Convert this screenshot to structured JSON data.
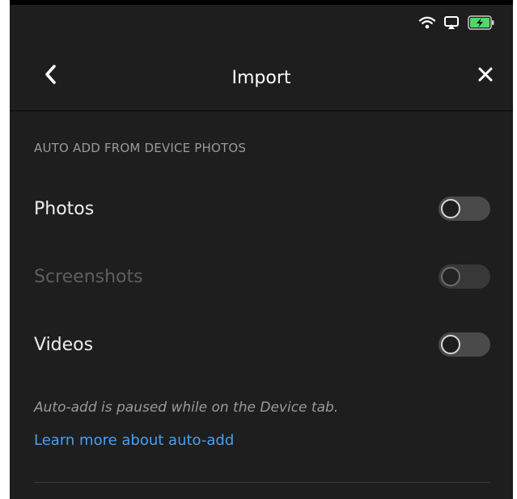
{
  "header": {
    "title": "Import"
  },
  "icons": {
    "back": "chevron-left-icon",
    "close": "close-icon",
    "wifi": "wifi-icon",
    "airplay": "airplay-icon",
    "battery": "battery-charging-icon"
  },
  "colors": {
    "background": "#1e1e1e",
    "text": "#eeeeee",
    "muted": "#9a9a9a",
    "link": "#4a9ff0",
    "battery": "#4cd964"
  },
  "section": {
    "header": "AUTO ADD FROM DEVICE PHOTOS",
    "items": [
      {
        "label": "Photos",
        "enabled": true,
        "on": false
      },
      {
        "label": "Screenshots",
        "enabled": false,
        "on": false
      },
      {
        "label": "Videos",
        "enabled": true,
        "on": false
      }
    ]
  },
  "note": "Auto-add is paused while on the Device tab.",
  "link": "Learn more about auto-add"
}
